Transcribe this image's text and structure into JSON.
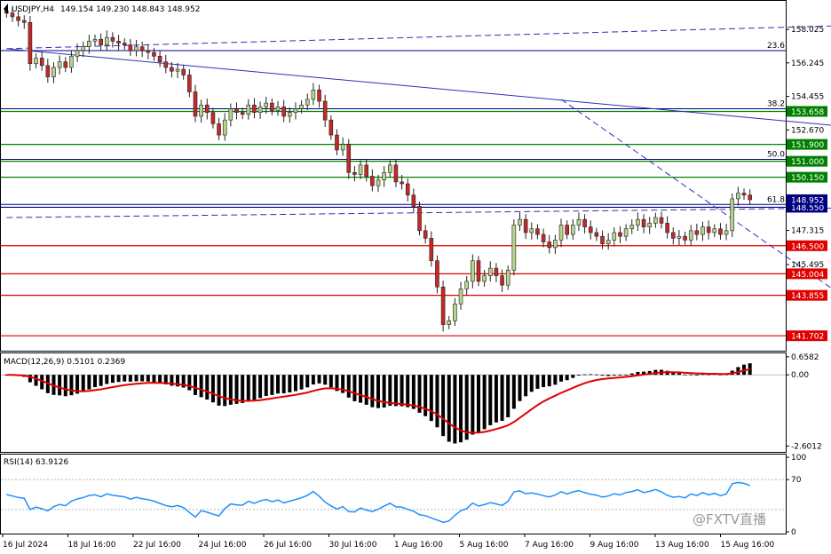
{
  "header": {
    "symbol": "USDJPY,H4",
    "ohlc": "149.154 149.230 148.843 148.952"
  },
  "watermark": "@FXTV直播",
  "colors": {
    "bull_body": "#b5d48c",
    "bear_body": "#c62828",
    "wick": "#222222",
    "support_line": "#e00000",
    "resistance_line": "#008000",
    "fib_line": "#000080",
    "trend_line": "#3030b0",
    "macd_hist": "#000000",
    "macd_signal": "#e00000",
    "rsi_line": "#1e90ff",
    "price_label_bg": "#000080",
    "support_label_bg": "#e00000",
    "resistance_label_bg": "#008000"
  },
  "chart_data": [
    {
      "type": "candlestick",
      "ylim": [
        141.0,
        159.5
      ],
      "y_ticks": [
        {
          "label": "158.025",
          "value": 158.025
        },
        {
          "label": "156.245",
          "value": 156.245
        },
        {
          "label": "154.455",
          "value": 154.455
        },
        {
          "label": "152.670",
          "value": 152.67
        },
        {
          "label": "147.315",
          "value": 147.315
        },
        {
          "label": "145.495",
          "value": 145.495
        }
      ],
      "fib_levels": [
        {
          "label": "23.6",
          "value": 156.9
        },
        {
          "label": "38.2",
          "value": 153.8
        },
        {
          "label": "50.0",
          "value": 151.1
        },
        {
          "label": "61.8",
          "value": 148.7
        }
      ],
      "horizontal_lines": [
        {
          "label": "153.658",
          "value": 153.658,
          "kind": "resistance"
        },
        {
          "label": "151.900",
          "value": 151.9,
          "kind": "resistance"
        },
        {
          "label": "151.000",
          "value": 151.0,
          "kind": "resistance"
        },
        {
          "label": "150.150",
          "value": 150.15,
          "kind": "resistance"
        },
        {
          "label": "148.550",
          "value": 148.55,
          "kind": "blue"
        },
        {
          "label": "146.500",
          "value": 146.5,
          "kind": "support"
        },
        {
          "label": "145.004",
          "value": 145.004,
          "kind": "support"
        },
        {
          "label": "143.855",
          "value": 143.855,
          "kind": "support"
        },
        {
          "label": "141.702",
          "value": 141.702,
          "kind": "support"
        }
      ],
      "current_price": {
        "label": "148.952",
        "value": 148.952
      },
      "x_labels": [
        "16 Jul 2024",
        "18 Jul 16:00",
        "22 Jul 16:00",
        "24 Jul 16:00",
        "26 Jul 16:00",
        "30 Jul 16:00",
        "1 Aug 16:00",
        "5 Aug 16:00",
        "7 Aug 16:00",
        "9 Aug 16:00",
        "13 Aug 16:00",
        "15 Aug 16:00"
      ],
      "closes": [
        158.9,
        158.7,
        158.5,
        158.4,
        156.2,
        156.5,
        156.1,
        155.5,
        156.0,
        156.3,
        156.0,
        156.6,
        156.9,
        157.1,
        157.4,
        157.5,
        157.2,
        157.6,
        157.4,
        157.3,
        157.2,
        156.9,
        157.1,
        156.9,
        156.8,
        156.6,
        156.3,
        156.0,
        155.8,
        155.9,
        155.6,
        154.7,
        153.4,
        154.0,
        153.6,
        153.0,
        152.4,
        153.2,
        153.8,
        153.6,
        153.5,
        154.0,
        153.6,
        153.9,
        154.1,
        153.7,
        153.9,
        153.4,
        153.6,
        153.8,
        154.0,
        154.3,
        154.8,
        154.2,
        153.2,
        152.4,
        151.6,
        151.9,
        150.4,
        150.3,
        150.8,
        150.2,
        149.7,
        150.0,
        150.4,
        150.8,
        149.9,
        149.8,
        149.2,
        148.6,
        147.3,
        146.9,
        145.7,
        144.3,
        142.3,
        142.5,
        143.4,
        144.2,
        144.6,
        145.7,
        144.6,
        144.9,
        145.3,
        144.9,
        144.4,
        145.2,
        147.6,
        147.9,
        147.2,
        147.4,
        147.1,
        146.7,
        146.4,
        146.8,
        147.6,
        147.1,
        147.6,
        147.9,
        147.5,
        147.2,
        147.0,
        146.6,
        146.8,
        147.2,
        147.0,
        147.4,
        147.6,
        147.9,
        147.5,
        147.7,
        148.0,
        147.7,
        147.2,
        146.9,
        147.0,
        146.8,
        147.3,
        147.1,
        147.5,
        147.2,
        147.4,
        147.1,
        147.3,
        149.0,
        149.3,
        149.2,
        148.95
      ],
      "trend_lines": [
        {
          "name": "upper-channel",
          "style": "dashed",
          "from": [
            0,
            157.0
          ],
          "to": [
            300,
            159.6
          ]
        },
        {
          "name": "falling-resistance",
          "style": "solid",
          "from": [
            0,
            157.0
          ],
          "to": [
            305,
            148.1
          ]
        },
        {
          "name": "lower-channel",
          "style": "dashed",
          "from": [
            0,
            148.0
          ],
          "to": [
            305,
            149.1
          ]
        },
        {
          "name": "steep-fall",
          "style": "dashed",
          "from": [
            94,
            154.3
          ],
          "to": [
            155,
            140.9
          ]
        }
      ]
    },
    {
      "type": "bar",
      "title": "MACD(12,26,9) 0.5101 0.2369",
      "ylim": [
        -2.75,
        0.72
      ],
      "y_ticks": [
        {
          "label": "0.6582",
          "value": 0.6582
        },
        {
          "label": "0.00",
          "value": 0.0
        },
        {
          "label": "-2.6012",
          "value": -2.6012
        }
      ]
    },
    {
      "type": "line",
      "title": "RSI(14) 63.9126",
      "ylim": [
        0,
        100
      ],
      "levels": [
        70,
        30
      ],
      "y_ticks": [
        {
          "label": "100",
          "value": 100
        },
        {
          "label": "70",
          "value": 70
        },
        {
          "label": "0",
          "value": 0
        }
      ]
    }
  ]
}
